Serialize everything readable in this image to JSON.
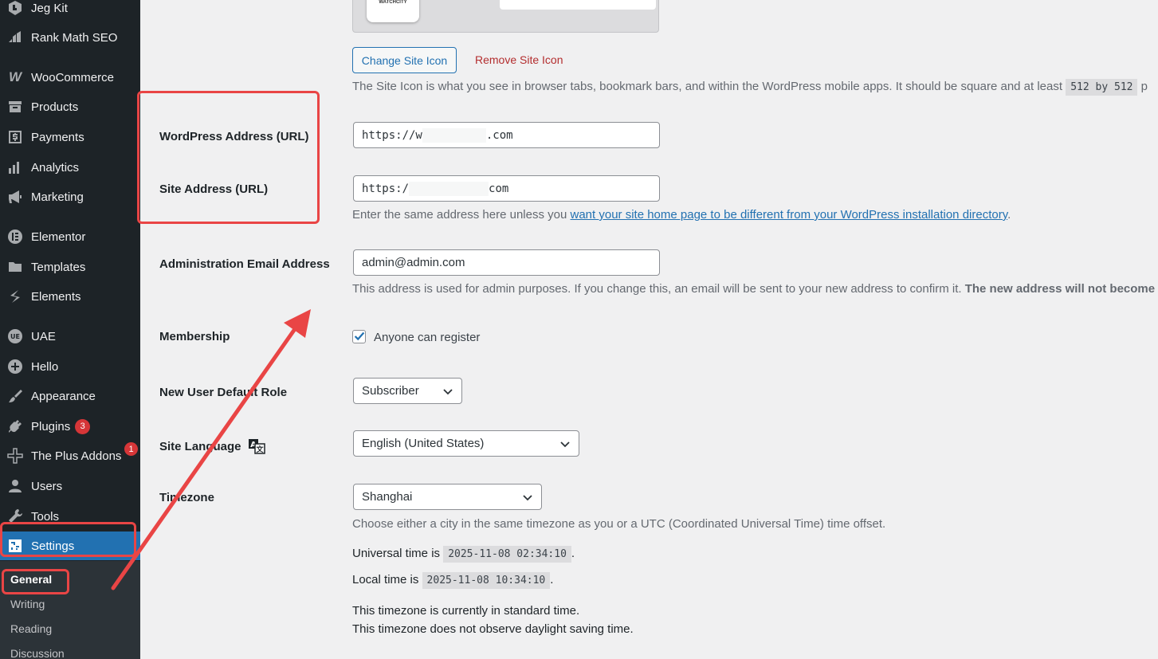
{
  "sidebar": {
    "items": [
      {
        "label": "Jeg Kit",
        "icon": "jegkit-icon"
      },
      {
        "label": "Rank Math SEO",
        "icon": "rankmath-icon"
      },
      {
        "label": "WooCommerce",
        "icon": "woocommerce-icon"
      },
      {
        "label": "Products",
        "icon": "archive-icon"
      },
      {
        "label": "Payments",
        "icon": "dollar-icon"
      },
      {
        "label": "Analytics",
        "icon": "bar-chart-icon"
      },
      {
        "label": "Marketing",
        "icon": "megaphone-icon"
      },
      {
        "label": "Elementor",
        "icon": "elementor-icon"
      },
      {
        "label": "Templates",
        "icon": "folder-icon"
      },
      {
        "label": "Elements",
        "icon": "elements-icon"
      },
      {
        "label": "UAE",
        "icon": "uae-icon"
      },
      {
        "label": "Hello",
        "icon": "plus-circle-icon"
      },
      {
        "label": "Appearance",
        "icon": "paintbrush-icon"
      },
      {
        "label": "Plugins",
        "icon": "plug-icon",
        "badge": "3"
      },
      {
        "label": "The Plus Addons",
        "icon": "plus-addons-icon",
        "badge": "1"
      },
      {
        "label": "Users",
        "icon": "user-icon"
      },
      {
        "label": "Tools",
        "icon": "wrench-icon"
      },
      {
        "label": "Settings",
        "icon": "settings-icon"
      }
    ],
    "submenu": [
      "General",
      "Writing",
      "Reading",
      "Discussion"
    ]
  },
  "site_icon": {
    "preview_text": "WATCHCITY",
    "change_label": "Change Site Icon",
    "remove_label": "Remove Site Icon",
    "description": "The Site Icon is what you see in browser tabs, bookmark bars, and within the WordPress mobile apps. It should be square and at least",
    "size_code": "512 by 512",
    "description_tail": "p"
  },
  "wp_address": {
    "label": "WordPress Address (URL)",
    "prefix": "https://w",
    "suffix": ".com"
  },
  "site_address": {
    "label": "Site Address (URL)",
    "prefix": "https:/",
    "suffix": "com",
    "desc_before": "Enter the same address here unless you",
    "desc_link": "want your site home page to be different from your WordPress installation directory",
    "desc_after": "."
  },
  "admin_email": {
    "label": "Administration Email Address",
    "value": "admin@admin.com",
    "desc": "This address is used for admin purposes. If you change this, an email will be sent to your new address to confirm it.",
    "desc_bold": "The new address will not become"
  },
  "membership": {
    "label": "Membership",
    "checkbox_label": "Anyone can register",
    "checked": true
  },
  "default_role": {
    "label": "New User Default Role",
    "value": "Subscriber"
  },
  "site_language": {
    "label": "Site Language",
    "value": "English (United States)"
  },
  "timezone": {
    "label": "Timezone",
    "value": "Shanghai",
    "desc": "Choose either a city in the same timezone as you or a UTC (Coordinated Universal Time) time offset.",
    "universal_label": "Universal time is",
    "universal_value": "2025-11-08 02:34:10",
    "local_label": "Local time is",
    "local_value": "2025-11-08 10:34:10",
    "period": ".",
    "standard_note": "This timezone is currently in standard time.",
    "dst_note": "This timezone does not observe daylight saving time."
  },
  "colors": {
    "accent": "#2271b1",
    "sidebar_bg": "#1d2327",
    "annotation": "#e94545"
  }
}
